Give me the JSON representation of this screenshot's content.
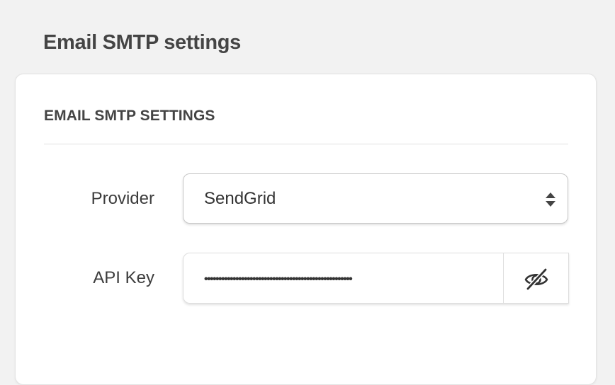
{
  "page": {
    "title": "Email SMTP settings"
  },
  "card": {
    "header": "EMAIL SMTP SETTINGS",
    "provider": {
      "label": "Provider",
      "value": "SendGrid"
    },
    "api_key": {
      "label": "API Key",
      "masked_value": "••••••••••••••••••••••••••••••••••••••••••••••••••••",
      "toggle_icon": "eye-slash-icon"
    }
  },
  "colors": {
    "background": "#f2f2f2",
    "card": "#ffffff",
    "text": "#3c3c3c",
    "border": "#c8c8c8"
  }
}
